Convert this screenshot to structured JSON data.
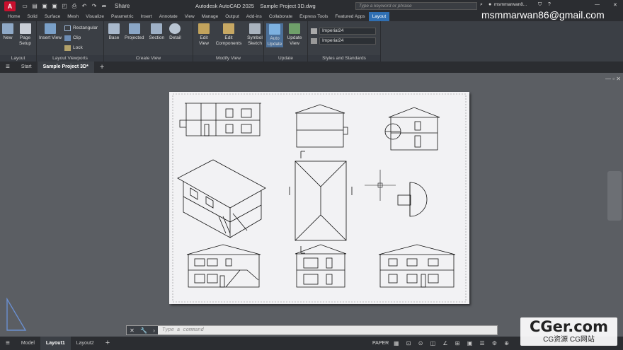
{
  "titlebar": {
    "logo": "A",
    "share": "Share",
    "app_title": "Autodesk AutoCAD 2025",
    "doc_title": "Sample Project 3D.dwg",
    "search_placeholder": "Type a keyword or phrase",
    "user": "msmmarwan8..."
  },
  "ribbon_tabs": [
    "Home",
    "Solid",
    "Surface",
    "Mesh",
    "Visualize",
    "Parametric",
    "Insert",
    "Annotate",
    "View",
    "Manage",
    "Output",
    "Add-ins",
    "Collaborate",
    "Express Tools",
    "Featured Apps",
    "Layout"
  ],
  "ribbon_active": "Layout",
  "panels": {
    "layout": {
      "title": "Layout",
      "tools": [
        {
          "label": "New"
        },
        {
          "label": "Page Setup"
        }
      ]
    },
    "viewports": {
      "title": "Layout Viewports",
      "insert": "Insert View",
      "rect": "Rectangular",
      "clip": "Clip",
      "lock": "Lock"
    },
    "create": {
      "title": "Create View",
      "tools": [
        {
          "label": "Base"
        },
        {
          "label": "Projected"
        },
        {
          "label": "Section"
        },
        {
          "label": "Detail"
        }
      ]
    },
    "modify": {
      "title": "Modify View",
      "tools": [
        {
          "label": "Edit View"
        },
        {
          "label": "Edit Components"
        },
        {
          "label": "Symbol Sketch"
        }
      ]
    },
    "update": {
      "title": "Update",
      "tools": [
        {
          "label": "Auto Update"
        },
        {
          "label": "Update View"
        }
      ]
    },
    "styles": {
      "title": "Styles and Standards",
      "sel1": "Imperial24",
      "sel2": "Imperial24"
    }
  },
  "doc_tabs": {
    "start": "Start",
    "active": "Sample Project 3D*"
  },
  "command": {
    "placeholder": "Type a command"
  },
  "status": {
    "tabs": [
      "Model",
      "Layout1",
      "Layout2"
    ],
    "active": "Layout1",
    "paper": "PAPER"
  },
  "overlay": {
    "email": "msmmarwan86@gmail.com",
    "brand": "CGer.com",
    "brand_sub": "CG资源 CG网站"
  },
  "colors": {
    "accent": "#2f6fb3",
    "dark": "#2b2d31"
  }
}
